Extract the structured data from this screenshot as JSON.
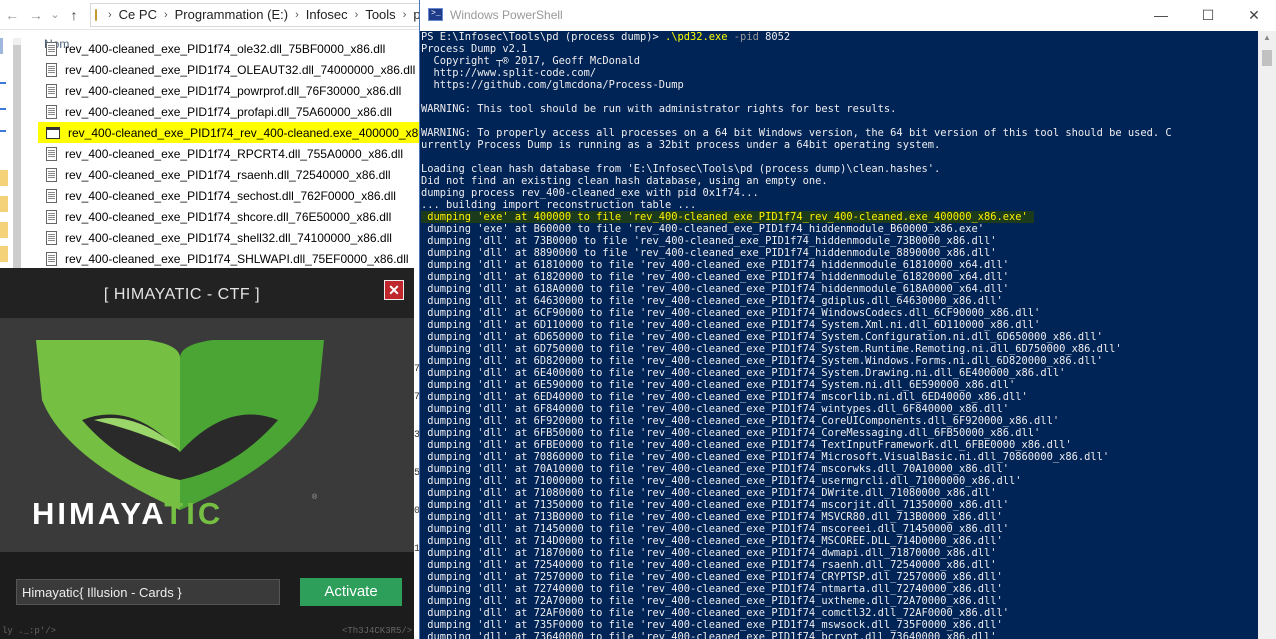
{
  "explorer": {
    "nav": {
      "back": "←",
      "forward": "→",
      "recent": "⌄",
      "up": "↑"
    },
    "breadcrumb": [
      "Ce PC",
      "Programmation (E:)",
      "Infosec",
      "Tools",
      "pd"
    ],
    "column_header": "Nom",
    "files": [
      {
        "name": "rev_400-cleaned_exe_PID1f74_ole32.dll_75BF0000_x86.dll",
        "selected": false
      },
      {
        "name": "rev_400-cleaned_exe_PID1f74_OLEAUT32.dll_74000000_x86.dll",
        "selected": false
      },
      {
        "name": "rev_400-cleaned_exe_PID1f74_powrprof.dll_76F30000_x86.dll",
        "selected": false
      },
      {
        "name": "rev_400-cleaned_exe_PID1f74_profapi.dll_75A60000_x86.dll",
        "selected": false
      },
      {
        "name": "rev_400-cleaned_exe_PID1f74_rev_400-cleaned.exe_400000_x86.exe",
        "selected": true
      },
      {
        "name": "rev_400-cleaned_exe_PID1f74_RPCRT4.dll_755A0000_x86.dll",
        "selected": false
      },
      {
        "name": "rev_400-cleaned_exe_PID1f74_rsaenh.dll_72540000_x86.dll",
        "selected": false
      },
      {
        "name": "rev_400-cleaned_exe_PID1f74_sechost.dll_762F0000_x86.dll",
        "selected": false
      },
      {
        "name": "rev_400-cleaned_exe_PID1f74_shcore.dll_76E50000_x86.dll",
        "selected": false
      },
      {
        "name": "rev_400-cleaned_exe_PID1f74_shell32.dll_74100000_x86.dll",
        "selected": false
      },
      {
        "name": "rev_400-cleaned_exe_PID1f74_SHLWAPI.dll_75EF0000_x86.dll",
        "selected": false
      }
    ],
    "highlight_color": "#ffff00"
  },
  "crackme": {
    "title": "[ HIMAYATIC - CTF ]",
    "close": "✕",
    "brand_main": "HIMAYA",
    "brand_accent": "TIC",
    "brand_mark": "®",
    "input_value": "Himayatic{ Illusion - Cards }",
    "activate_label": "Activate",
    "footer_left": "ly ._:p'/>",
    "footer_right": "<Th3J4CK3R5/>",
    "accent_color": "#75c043",
    "button_color": "#2e9e5b"
  },
  "strip": [
    "7",
    "7",
    "3",
    "5",
    "0",
    "1"
  ],
  "powershell": {
    "title": "Windows PowerShell",
    "minimize": "—",
    "maximize": "☐",
    "close": "✕",
    "prompt": "PS E:\\Infosec\\Tools\\pd (process dump)> ",
    "command": ".\\pd32.exe",
    "param": " -pid ",
    "pid": "8052",
    "output": [
      "Process Dump v2.1",
      "  Copyright ┬® 2017, Geoff McDonald",
      "  http://www.split-code.com/",
      "  https://github.com/glmcdona/Process-Dump",
      "",
      "WARNING: This tool should be run with administrator rights for best results.",
      "",
      "WARNING: To properly access all processes on a 64 bit Windows version, the 64 bit version of this tool should be used. C",
      "urrently Process Dump is running as a 32bit process under a 64bit operating system.",
      "",
      "Loading clean hash database from 'E:\\Infosec\\Tools\\pd (process dump)\\clean.hashes'.",
      "Did not find an existing clean hash database, using an empty one.",
      "dumping process rev_400-cleaned_exe with pid 0x1f74...",
      "... building import reconstruction table ..."
    ],
    "highlighted_line": " dumping 'exe' at 400000 to file 'rev_400-cleaned_exe_PID1f74_rev_400-cleaned.exe_400000_x86.exe' ",
    "dump_lines": [
      " dumping 'exe' at B60000 to file 'rev_400-cleaned_exe_PID1f74_hiddenmodule_B60000_x86.exe'",
      " dumping 'dll' at 73B0000 to file 'rev_400-cleaned_exe_PID1f74_hiddenmodule_73B0000_x86.dll'",
      " dumping 'dll' at 8890000 to file 'rev_400-cleaned_exe_PID1f74_hiddenmodule_8890000_x86.dll'",
      " dumping 'dll' at 61810000 to file 'rev_400-cleaned_exe_PID1f74_hiddenmodule_61810000_x64.dll'",
      " dumping 'dll' at 61820000 to file 'rev_400-cleaned_exe_PID1f74_hiddenmodule_61820000_x64.dll'",
      " dumping 'dll' at 618A0000 to file 'rev_400-cleaned_exe_PID1f74_hiddenmodule_618A0000_x64.dll'",
      " dumping 'dll' at 64630000 to file 'rev_400-cleaned_exe_PID1f74_gdiplus.dll_64630000_x86.dll'",
      " dumping 'dll' at 6CF90000 to file 'rev_400-cleaned_exe_PID1f74_WindowsCodecs.dll_6CF90000_x86.dll'",
      " dumping 'dll' at 6D110000 to file 'rev_400-cleaned_exe_PID1f74_System.Xml.ni.dll_6D110000_x86.dll'",
      " dumping 'dll' at 6D650000 to file 'rev_400-cleaned_exe_PID1f74_System.Configuration.ni.dll_6D650000_x86.dll'",
      " dumping 'dll' at 6D750000 to file 'rev_400-cleaned_exe_PID1f74_System.Runtime.Remoting.ni.dll_6D750000_x86.dll'",
      " dumping 'dll' at 6D820000 to file 'rev_400-cleaned_exe_PID1f74_System.Windows.Forms.ni.dll_6D820000_x86.dll'",
      " dumping 'dll' at 6E400000 to file 'rev_400-cleaned_exe_PID1f74_System.Drawing.ni.dll_6E400000_x86.dll'",
      " dumping 'dll' at 6E590000 to file 'rev_400-cleaned_exe_PID1f74_System.ni.dll_6E590000_x86.dll'",
      " dumping 'dll' at 6ED40000 to file 'rev_400-cleaned_exe_PID1f74_mscorlib.ni.dll_6ED40000_x86.dll'",
      " dumping 'dll' at 6F840000 to file 'rev_400-cleaned_exe_PID1f74_wintypes.dll_6F840000_x86.dll'",
      " dumping 'dll' at 6F920000 to file 'rev_400-cleaned_exe_PID1f74_CoreUIComponents.dll_6F920000_x86.dll'",
      " dumping 'dll' at 6FB50000 to file 'rev_400-cleaned_exe_PID1f74_CoreMessaging.dll_6FB50000_x86.dll'",
      " dumping 'dll' at 6FBE0000 to file 'rev_400-cleaned_exe_PID1f74_TextInputFramework.dll_6FBE0000_x86.dll'",
      " dumping 'dll' at 70860000 to file 'rev_400-cleaned_exe_PID1f74_Microsoft.VisualBasic.ni.dll_70860000_x86.dll'",
      " dumping 'dll' at 70A10000 to file 'rev_400-cleaned_exe_PID1f74_mscorwks.dll_70A10000_x86.dll'",
      " dumping 'dll' at 71000000 to file 'rev_400-cleaned_exe_PID1f74_usermgrcli.dll_71000000_x86.dll'",
      " dumping 'dll' at 71080000 to file 'rev_400-cleaned_exe_PID1f74_DWrite.dll_71080000_x86.dll'",
      " dumping 'dll' at 71350000 to file 'rev_400-cleaned_exe_PID1f74_mscorjit.dll_71350000_x86.dll'",
      " dumping 'dll' at 713B0000 to file 'rev_400-cleaned_exe_PID1f74_MSVCR80.dll_713B0000_x86.dll'",
      " dumping 'dll' at 71450000 to file 'rev_400-cleaned_exe_PID1f74_mscoreei.dll_71450000_x86.dll'",
      " dumping 'dll' at 714D0000 to file 'rev_400-cleaned_exe_PID1f74_MSCOREE.DLL_714D0000_x86.dll'",
      " dumping 'dll' at 71870000 to file 'rev_400-cleaned_exe_PID1f74_dwmapi.dll_71870000_x86.dll'",
      " dumping 'dll' at 72540000 to file 'rev_400-cleaned_exe_PID1f74_rsaenh.dll_72540000_x86.dll'",
      " dumping 'dll' at 72570000 to file 'rev_400-cleaned_exe_PID1f74_CRYPTSP.dll_72570000_x86.dll'",
      " dumping 'dll' at 72740000 to file 'rev_400-cleaned_exe_PID1f74_ntmarta.dll_72740000_x86.dll'",
      " dumping 'dll' at 72A70000 to file 'rev_400-cleaned_exe_PID1f74_uxtheme.dll_72A70000_x86.dll'",
      " dumping 'dll' at 72AF0000 to file 'rev_400-cleaned_exe_PID1f74_comctl32.dll_72AF0000_x86.dll'",
      " dumping 'dll' at 735F0000 to file 'rev_400-cleaned_exe_PID1f74_mswsock.dll_735F0000_x86.dll'",
      " dumping 'dll' at 73640000 to file 'rev_400-cleaned_exe_PID1f74_bcrypt.dll_73640000_x86.dll'"
    ],
    "console_bg": "#012456",
    "command_color": "#ffff00"
  }
}
